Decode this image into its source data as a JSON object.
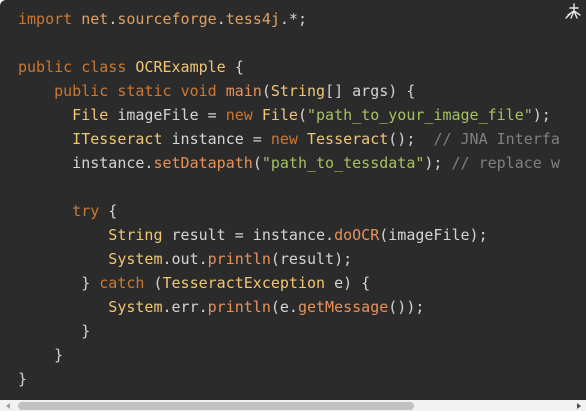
{
  "code_lines": [
    [
      {
        "t": "import ",
        "c": "kw"
      },
      {
        "t": "net",
        "c": "pkg"
      },
      {
        "t": ".",
        "c": "pl"
      },
      {
        "t": "sourceforge",
        "c": "pkg"
      },
      {
        "t": ".",
        "c": "pl"
      },
      {
        "t": "tess4j",
        "c": "pkg"
      },
      {
        "t": ".*",
        "c": "pl"
      },
      {
        "t": ";",
        "c": "pl"
      }
    ],
    [],
    [
      {
        "t": "public ",
        "c": "kw"
      },
      {
        "t": "class ",
        "c": "kw"
      },
      {
        "t": "OCRExample",
        "c": "cls"
      },
      {
        "t": " {",
        "c": "pl"
      }
    ],
    [
      {
        "t": "    public ",
        "c": "kw"
      },
      {
        "t": "static ",
        "c": "kw"
      },
      {
        "t": "void ",
        "c": "kw"
      },
      {
        "t": "main",
        "c": "fn"
      },
      {
        "t": "(",
        "c": "pl"
      },
      {
        "t": "String",
        "c": "cls"
      },
      {
        "t": "[] args) {",
        "c": "pl"
      }
    ],
    [
      {
        "t": "      File",
        "c": "cls"
      },
      {
        "t": " imageFile = ",
        "c": "pl"
      },
      {
        "t": "new ",
        "c": "kw"
      },
      {
        "t": "File",
        "c": "cls"
      },
      {
        "t": "(",
        "c": "pl"
      },
      {
        "t": "\"path_to_your_image_file\"",
        "c": "str"
      },
      {
        "t": ");",
        "c": "pl"
      }
    ],
    [
      {
        "t": "      ITesseract",
        "c": "cls"
      },
      {
        "t": " instance = ",
        "c": "pl"
      },
      {
        "t": "new ",
        "c": "kw"
      },
      {
        "t": "Tesseract",
        "c": "cls"
      },
      {
        "t": "();  ",
        "c": "pl"
      },
      {
        "t": "// JNA Interfa",
        "c": "cm"
      }
    ],
    [
      {
        "t": "      instance.",
        "c": "pl"
      },
      {
        "t": "setDatapath",
        "c": "fn"
      },
      {
        "t": "(",
        "c": "pl"
      },
      {
        "t": "\"path_to_tessdata\"",
        "c": "str"
      },
      {
        "t": "); ",
        "c": "pl"
      },
      {
        "t": "// replace w",
        "c": "cm"
      }
    ],
    [],
    [
      {
        "t": "      try",
        "c": "kw"
      },
      {
        "t": " {",
        "c": "pl"
      }
    ],
    [
      {
        "t": "          String",
        "c": "cls"
      },
      {
        "t": " result = instance.",
        "c": "pl"
      },
      {
        "t": "doOCR",
        "c": "fn"
      },
      {
        "t": "(imageFile);",
        "c": "pl"
      }
    ],
    [
      {
        "t": "          System",
        "c": "cls"
      },
      {
        "t": ".out.",
        "c": "pl"
      },
      {
        "t": "println",
        "c": "fn"
      },
      {
        "t": "(result);",
        "c": "pl"
      }
    ],
    [
      {
        "t": "       } ",
        "c": "pl"
      },
      {
        "t": "catch",
        "c": "kw"
      },
      {
        "t": " (",
        "c": "pl"
      },
      {
        "t": "TesseractException",
        "c": "cls"
      },
      {
        "t": " e) {",
        "c": "pl"
      }
    ],
    [
      {
        "t": "          System",
        "c": "cls"
      },
      {
        "t": ".err.",
        "c": "pl"
      },
      {
        "t": "println",
        "c": "fn"
      },
      {
        "t": "(e.",
        "c": "pl"
      },
      {
        "t": "getMessage",
        "c": "fn"
      },
      {
        "t": "());",
        "c": "pl"
      }
    ],
    [
      {
        "t": "       }",
        "c": "pl"
      }
    ],
    [
      {
        "t": "    }",
        "c": "pl"
      }
    ],
    [
      {
        "t": "}",
        "c": "pl"
      }
    ]
  ],
  "icons": {
    "copy": "copy-code-icon",
    "scroll_left": "scroll-left-arrow-icon",
    "scroll_right": "scroll-right-arrow-icon"
  },
  "colors": {
    "background": "#2b2b2b",
    "keyword": "#cc7832",
    "package": "#e0a060",
    "class_name": "#f0c674",
    "string": "#a5c261",
    "method": "#e8915b",
    "comment": "#808080",
    "plain": "#d4d4d4"
  }
}
